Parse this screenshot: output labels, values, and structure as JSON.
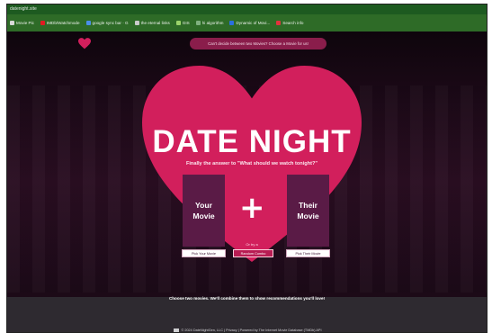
{
  "browser": {
    "tab_title": "datenight.site",
    "bookmarks": [
      {
        "label": "Movie Pic",
        "color": "#d8d8d8"
      },
      {
        "label": "IMDb/Watchmode",
        "color": "#e11b22"
      },
      {
        "label": "google sync bar · G",
        "color": "#4a8ee8"
      },
      {
        "label": "the eternal links",
        "color": "#c9c9c9"
      },
      {
        "label": "GIS",
        "color": "#9bd36a"
      },
      {
        "label": "hi algorithm",
        "color": "#7fb07f"
      },
      {
        "label": "Dynamic of Movi...",
        "color": "#2a6fe0"
      },
      {
        "label": "Search info",
        "color": "#e0323c"
      }
    ]
  },
  "site": {
    "promo": "Can't decide between two Movies? Choose a Movie for us!",
    "title": "DATE NIGHT",
    "subtitle": "Finally the answer to \"What should we watch tonight?\"",
    "left_poster": "Your Movie",
    "right_poster": "Their Movie",
    "plus": "+",
    "or_label": "Or try a",
    "pick_your": "Pick Your Movie",
    "random": "Random Combo",
    "pick_their": "Pick Their Movie",
    "footer_text": "Choose two movies. We'll combine them to show recommendations you'll love!",
    "copyright": "© 2024  DateNightGen, LLC | Privacy | Powered by The Internet Movie Database (TMDb) API"
  },
  "colors": {
    "heart": "#d21f5c",
    "poster": "#5a1b46",
    "background": "#1e0a19"
  }
}
